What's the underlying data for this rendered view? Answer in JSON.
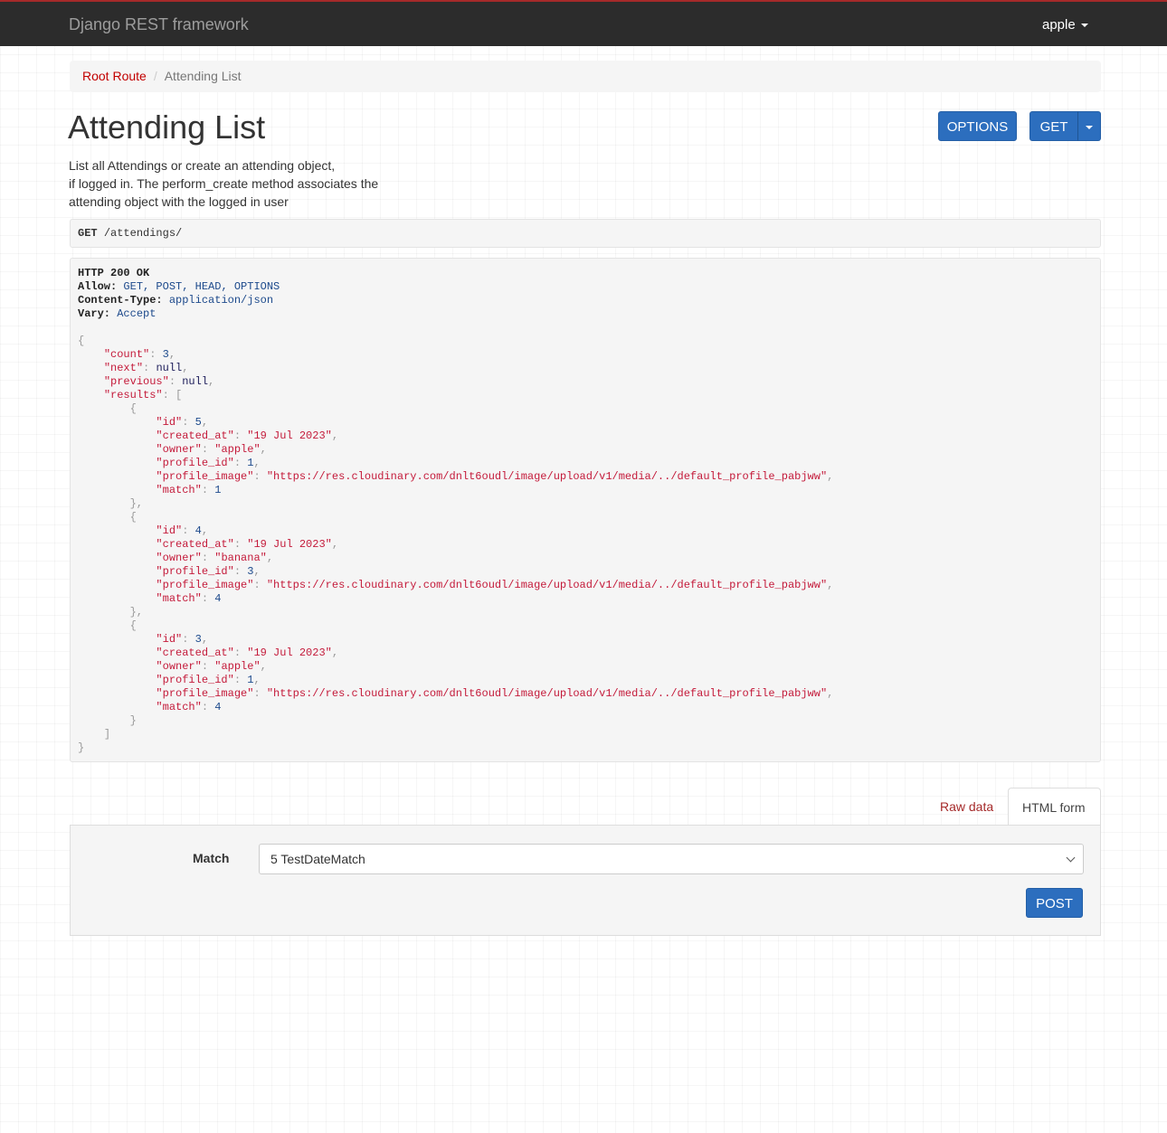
{
  "navbar": {
    "brand": "Django REST framework",
    "user": "apple"
  },
  "breadcrumb": {
    "root": "Root Route",
    "current": "Attending List"
  },
  "page": {
    "title": "Attending List",
    "description": [
      "List all Attendings or create an attending object,",
      "if logged in. The perform_create method associates the",
      "attending object with the logged in user"
    ]
  },
  "actions": {
    "options_label": "OPTIONS",
    "get_label": "GET"
  },
  "request": {
    "method": "GET",
    "path": "/attendings/"
  },
  "response": {
    "status": "HTTP 200 OK",
    "headers": [
      {
        "key": "Allow:",
        "value": "GET, POST, HEAD, OPTIONS"
      },
      {
        "key": "Content-Type:",
        "value": "application/json"
      },
      {
        "key": "Vary:",
        "value": "Accept"
      }
    ],
    "count": "3",
    "next": "null",
    "previous": "null",
    "results": [
      {
        "id": "5",
        "created_at": "\"19 Jul 2023\"",
        "owner": "\"apple\"",
        "profile_id": "1",
        "profile_image": "\"https://res.cloudinary.com/dnlt6oudl/image/upload/v1/media/../default_profile_pabjww\"",
        "match": "1"
      },
      {
        "id": "4",
        "created_at": "\"19 Jul 2023\"",
        "owner": "\"banana\"",
        "profile_id": "3",
        "profile_image": "\"https://res.cloudinary.com/dnlt6oudl/image/upload/v1/media/../default_profile_pabjww\"",
        "match": "4"
      },
      {
        "id": "3",
        "created_at": "\"19 Jul 2023\"",
        "owner": "\"apple\"",
        "profile_id": "1",
        "profile_image": "\"https://res.cloudinary.com/dnlt6oudl/image/upload/v1/media/../default_profile_pabjww\"",
        "match": "4"
      }
    ]
  },
  "tabs": {
    "raw": "Raw data",
    "html": "HTML form"
  },
  "form": {
    "match_label": "Match",
    "match_value": "5 TestDateMatch",
    "post_label": "POST"
  }
}
